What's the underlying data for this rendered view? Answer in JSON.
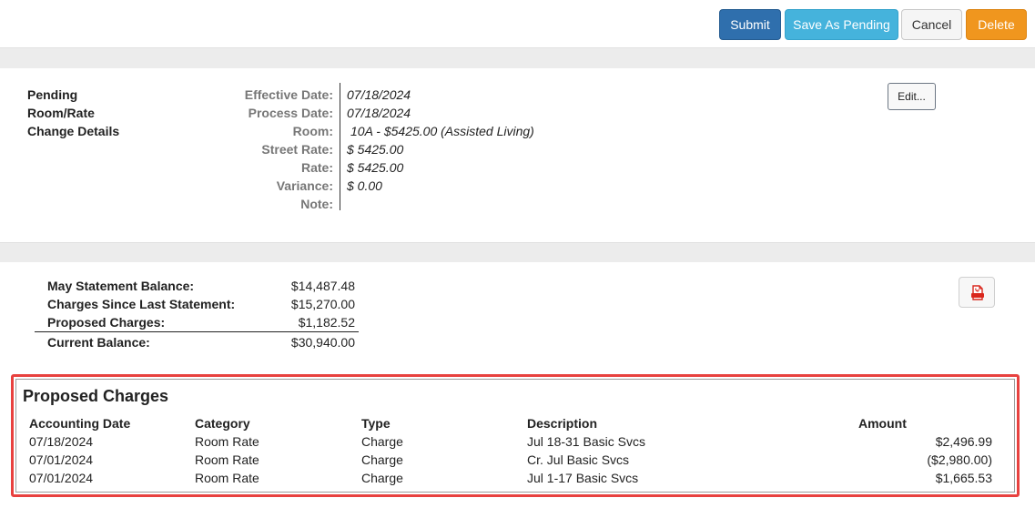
{
  "toolbar": {
    "submit_label": "Submit",
    "save_pending_label": "Save As Pending",
    "cancel_label": "Cancel",
    "delete_label": "Delete"
  },
  "status": {
    "line1": "Pending",
    "line2": "Room/Rate",
    "line3": "Change Details"
  },
  "details": {
    "effective_date_label": "Effective Date:",
    "effective_date": "07/18/2024",
    "process_date_label": "Process Date:",
    "process_date": "07/18/2024",
    "room_label": "Room:",
    "room": "10A - $5425.00 (Assisted Living)",
    "street_rate_label": "Street Rate:",
    "street_rate": "$ 5425.00",
    "rate_label": "Rate:",
    "rate": "$ 5425.00",
    "variance_label": "Variance:",
    "variance": "$ 0.00",
    "note_label": "Note:",
    "note": "",
    "edit_label": "Edit..."
  },
  "balance": {
    "statement_label": "May Statement Balance:",
    "statement_value": "$14,487.48",
    "since_label": "Charges Since Last Statement:",
    "since_value": "$15,270.00",
    "proposed_label": "Proposed Charges:",
    "proposed_value": "$1,182.52",
    "current_label": "Current Balance:",
    "current_value": "$30,940.00"
  },
  "charges": {
    "title": "Proposed Charges",
    "columns": [
      "Accounting Date",
      "Category",
      "Type",
      "Description",
      "Amount"
    ],
    "rows": [
      [
        "07/18/2024",
        "Room Rate",
        "Charge",
        "Jul 18-31 Basic Svcs",
        "$2,496.99"
      ],
      [
        "07/01/2024",
        "Room Rate",
        "Charge",
        "Cr. Jul Basic Svcs",
        "($2,980.00)"
      ],
      [
        "07/01/2024",
        "Room Rate",
        "Charge",
        "Jul 1-17 Basic Svcs",
        "$1,665.53"
      ]
    ]
  },
  "icons": {
    "pdf": "pdf-icon"
  },
  "colors": {
    "submit": "#2f6fad",
    "save_pending": "#45b3dc",
    "delete": "#f0961e",
    "highlight_border": "#e8413f"
  }
}
